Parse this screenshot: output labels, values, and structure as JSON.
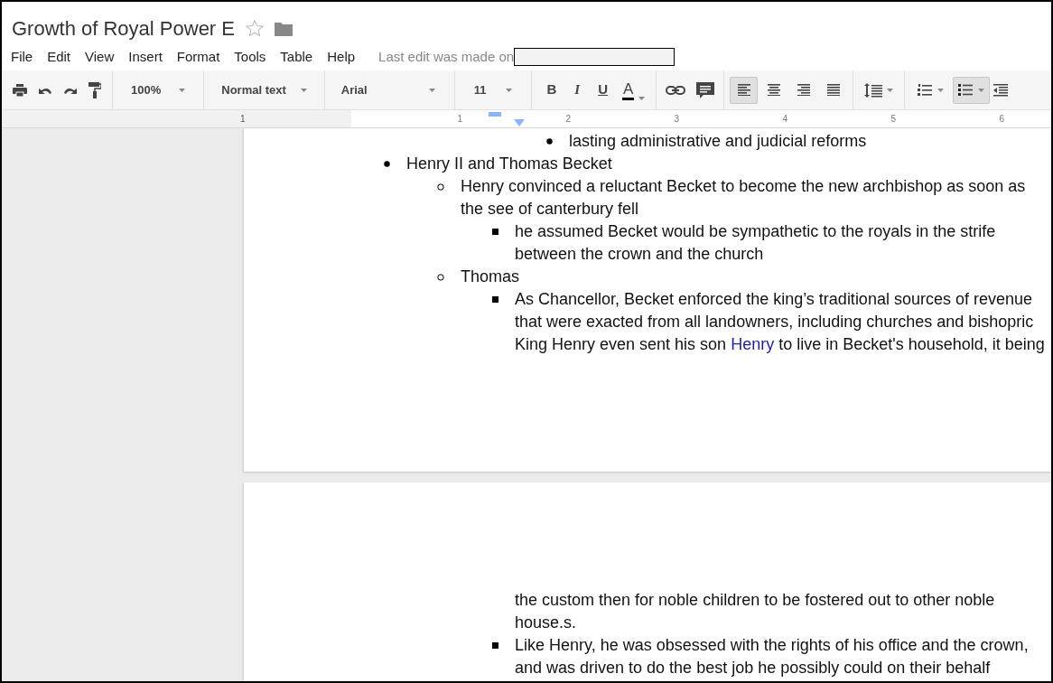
{
  "document": {
    "title": "Growth of Royal Power E",
    "starred": false
  },
  "menu": [
    "File",
    "Edit",
    "View",
    "Insert",
    "Format",
    "Tools",
    "Table",
    "Help"
  ],
  "last_edit": "Last edit was made on",
  "toolbar": {
    "zoom": "100%",
    "style": "Normal text",
    "font": "Arial",
    "size": "11",
    "bold": "B",
    "italic": "I",
    "underline": "U",
    "text_color": "A",
    "alignments": [
      {
        "kind": "left",
        "selected": true
      },
      {
        "kind": "center",
        "selected": false
      },
      {
        "kind": "right",
        "selected": false
      },
      {
        "kind": "justify",
        "selected": false
      }
    ],
    "lists": [
      {
        "kind": "numbered",
        "selected": false
      },
      {
        "kind": "bulleted",
        "selected": true
      }
    ]
  },
  "ruler": [
    "1",
    "1",
    "2",
    "3",
    "4",
    "5",
    "6"
  ],
  "pages": [
    {
      "items": [
        {
          "children": [
            {
              "children": [
                {
                  "children": [
                    {
                      "kind": "bullet",
                      "lines": [
                        "lasting administrative and judicial reforms"
                      ]
                    }
                  ]
                }
              ]
            }
          ]
        },
        {
          "kind": "bullet",
          "lines": [
            "Henry II and Thomas Becket"
          ],
          "children": [
            {
              "kind": "bullet",
              "lines": [
                "Henry convinced a reluctant Becket to become the new archbishop as soon as",
                "the see of canterbury fell"
              ],
              "children": [
                {
                  "kind": "bullet",
                  "lines": [
                    "he assumed Becket would be sympathetic to the royals in the strife",
                    "between the crown and the church"
                  ]
                }
              ]
            },
            {
              "kind": "bullet",
              "lines": [
                "Thomas"
              ],
              "children": [
                {
                  "kind": "bullet",
                  "lines": [
                    "As Chancellor, Becket enforced the king’s traditional sources of revenue",
                    "that were exacted from all landowners, including churches and bishopric",
                    [
                      {
                        "text": "King Henry even sent his son ",
                        "link": false
                      },
                      {
                        "text": "Henry",
                        "link": true
                      },
                      {
                        "text": " to live in Becket's household, it being",
                        "link": false
                      }
                    ]
                  ]
                }
              ]
            }
          ]
        }
      ]
    },
    {
      "items": [
        {
          "children": [
            {
              "children": [
                {
                  "kind": "continuation",
                  "lines": [
                    "the custom then for noble children to be fostered out to other noble",
                    "house.s."
                  ]
                },
                {
                  "kind": "bullet",
                  "lines": [
                    "Like Henry, he was obsessed with the rights of his office and the crown,",
                    "and was driven to do the best job he possibly could on their behalf"
                  ]
                }
              ]
            }
          ]
        }
      ]
    }
  ]
}
